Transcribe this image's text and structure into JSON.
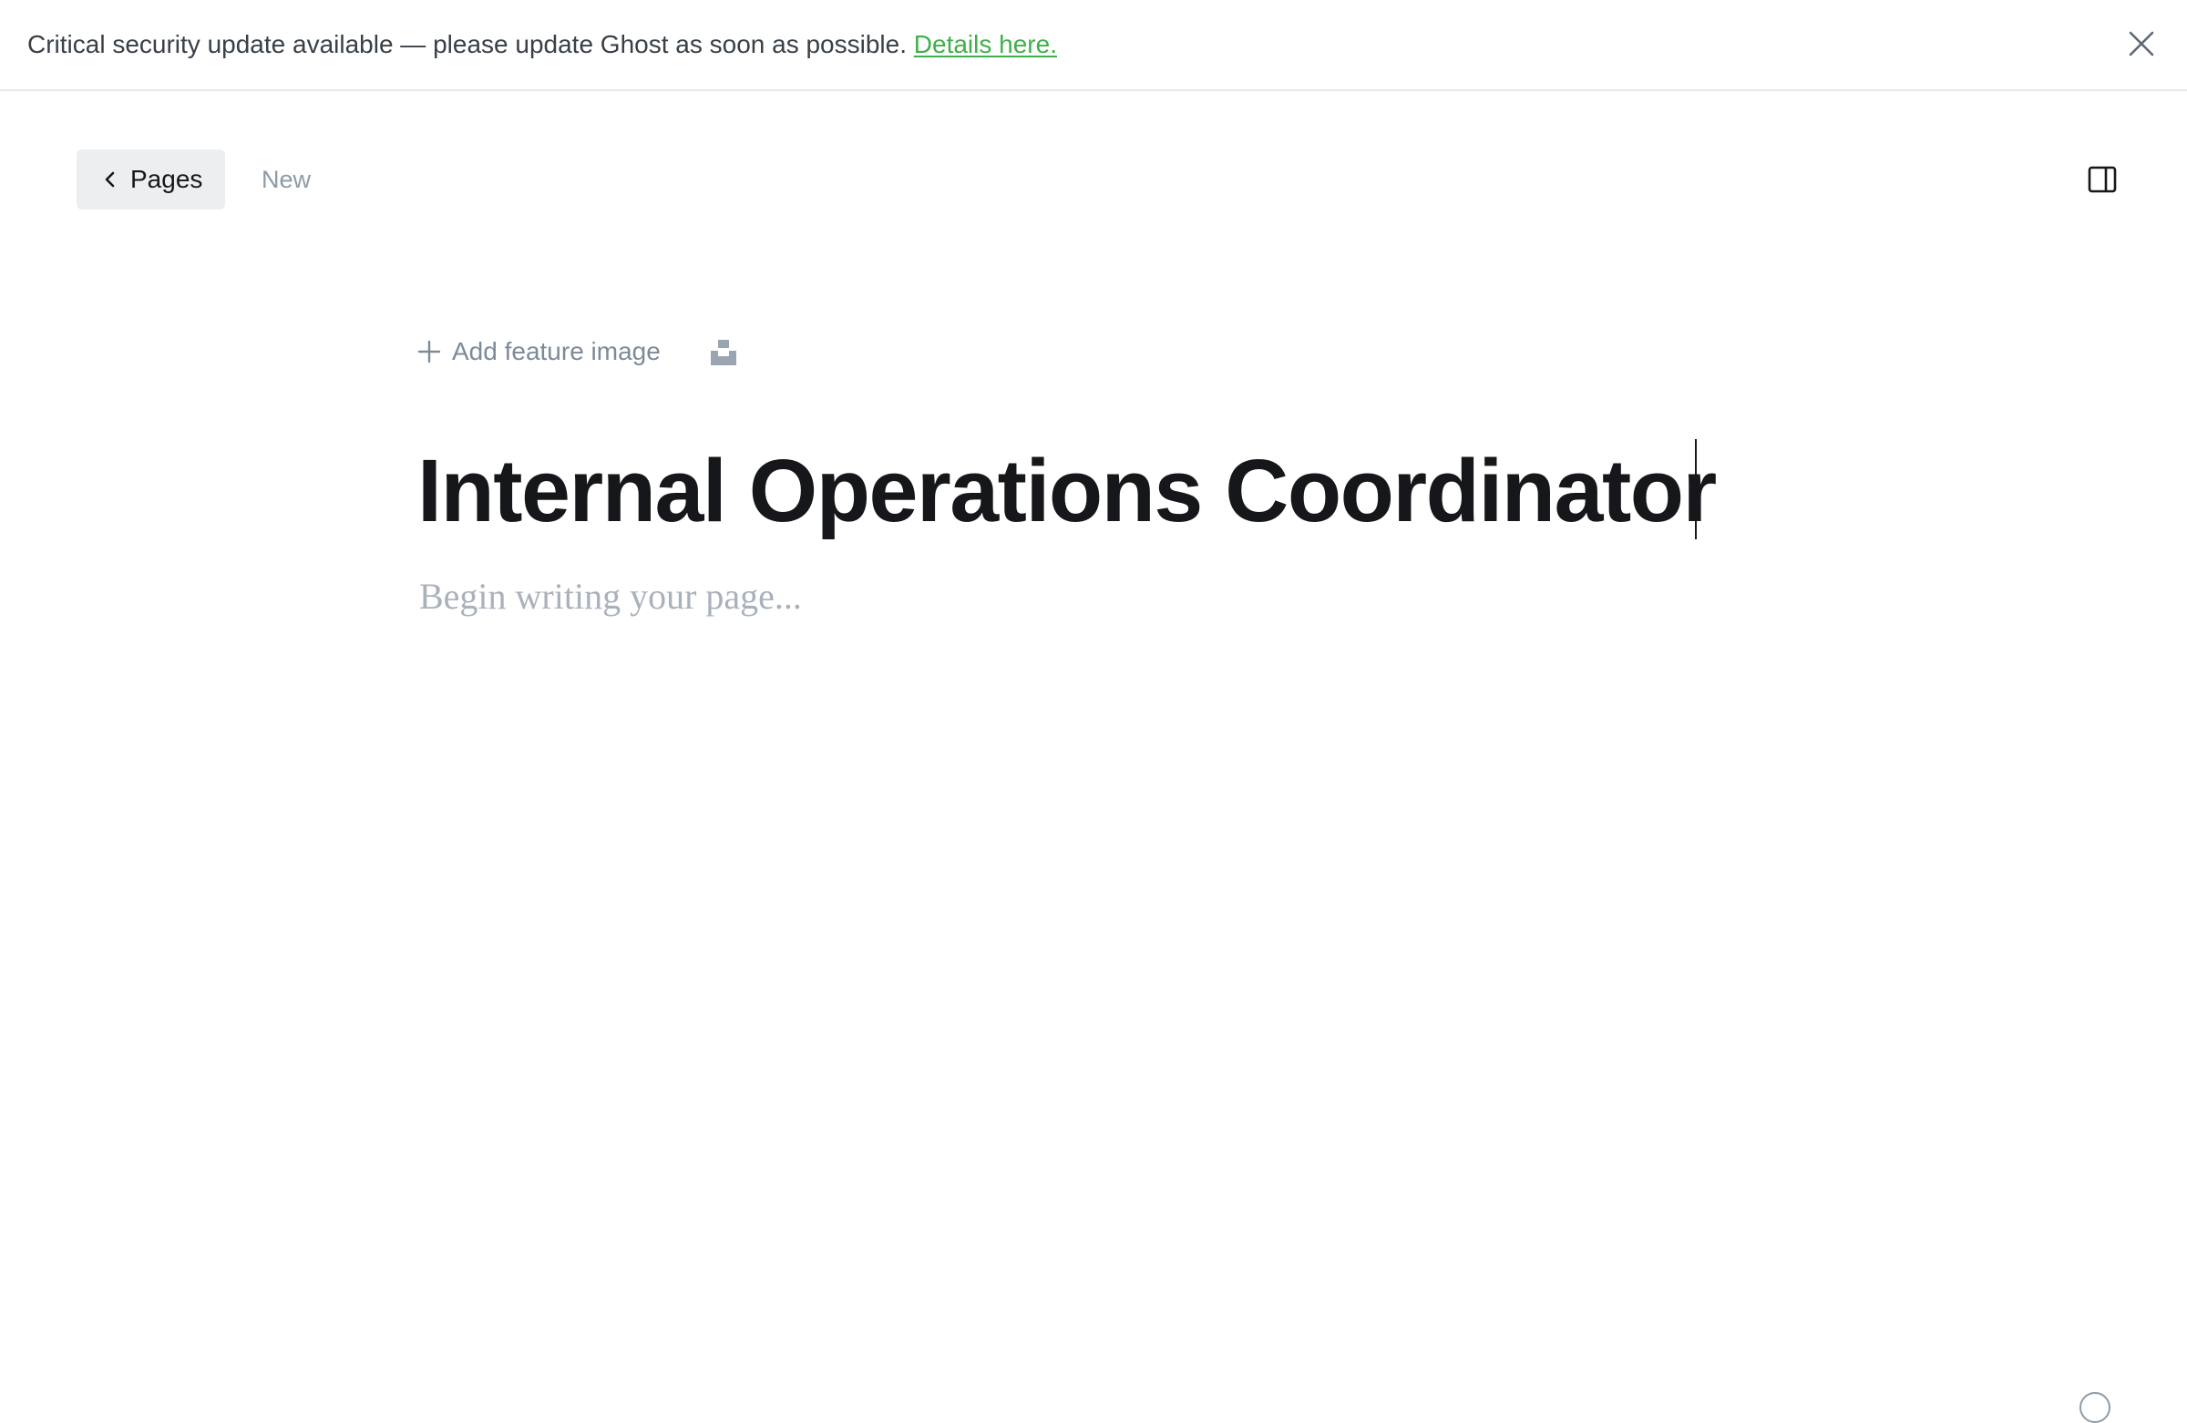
{
  "alert": {
    "message": "Critical security update available — please update Ghost as soon as possible.",
    "link_label": "Details here.",
    "link_color": "#3eb04a",
    "close_icon": "close-icon"
  },
  "header": {
    "back_label": "Pages",
    "back_icon": "chevron-left-icon",
    "status": "New",
    "sidebar_toggle_icon": "sidebar-panel-icon"
  },
  "editor": {
    "feature_image_label": "Add feature image",
    "feature_image_icon": "plus-icon",
    "unsplash_icon": "unsplash-icon",
    "title": "Internal Operations Coordinator",
    "body_placeholder": "Begin writing your page..."
  },
  "footer": {
    "word_count": "",
    "help_icon": "help-icon"
  }
}
